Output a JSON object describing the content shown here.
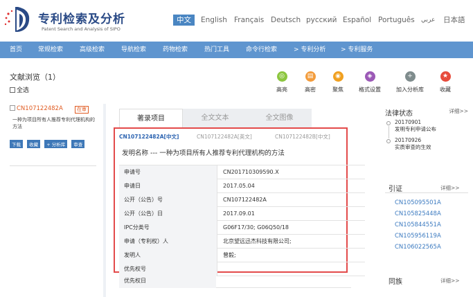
{
  "header": {
    "title": "专利检索及分析",
    "subtitle": "Patent Search and Analysis of SIPO"
  },
  "languages": [
    "中文",
    "English",
    "Français",
    "Deutsch",
    "русский",
    "Español",
    "Português",
    "عربي",
    "日本語"
  ],
  "nav": [
    "首页",
    "常规检索",
    "高级检索",
    "导航检索",
    "药物检索",
    "热门工具",
    "命令行检索",
    "> 专利分析",
    "> 专利服务"
  ],
  "toolbar": {
    "doc_browse": "文献浏览（1）",
    "select_all": "全选",
    "tools": [
      {
        "label": "高亮",
        "icon": "highlight-icon",
        "color": "#8cc63f",
        "glyph": "◎"
      },
      {
        "label": "高密",
        "icon": "dense-icon",
        "color": "#f39c3c",
        "glyph": "▤"
      },
      {
        "label": "聚焦",
        "icon": "focus-icon",
        "color": "#f0a020",
        "glyph": "◉"
      },
      {
        "label": "格式设置",
        "icon": "format-icon",
        "color": "#9b59b6",
        "glyph": "◈"
      },
      {
        "label": "加入分析库",
        "icon": "add-analysis-icon",
        "color": "#7f8c8d",
        "glyph": "+"
      },
      {
        "label": "收藏",
        "icon": "favorite-icon",
        "color": "#e74c3c",
        "glyph": "★"
      }
    ]
  },
  "left_list": {
    "id": "CN107122482A",
    "badge": "在审",
    "desc": "一种为项目所有人推荐专利代理机构的方法",
    "buttons": [
      "下载",
      "收藏",
      "+ 分析库",
      "审查"
    ]
  },
  "tabs": [
    "著录项目",
    "全文文本",
    "全文图像"
  ],
  "sub_tabs": [
    "CN107122482A[中文]",
    "CN107122482A[英文]",
    "CN107122482B[中文]"
  ],
  "invention_title": "发明名称 --- 一种为项目所有人推荐专利代理机构的方法",
  "table": [
    {
      "k": "申请号",
      "v": "CN201710309590.X"
    },
    {
      "k": "申请日",
      "v": "2017.05.04"
    },
    {
      "k": "公开（公告）号",
      "v": "CN107122482A"
    },
    {
      "k": "公开（公告）日",
      "v": "2017.09.01"
    },
    {
      "k": "IPC分类号",
      "v": "G06F17/30; G06Q50/18"
    },
    {
      "k": "申请（专利权）人",
      "v": "北京望远迅杰科技有限公司;"
    },
    {
      "k": "发明人",
      "v": "曾毅;"
    },
    {
      "k": "优先权号",
      "v": ""
    }
  ],
  "extra_row": "优先权日",
  "legal_status": {
    "title": "法律状态",
    "more": "详细>>",
    "events": [
      {
        "date": "20170901",
        "text": "发明专利申请公布"
      },
      {
        "date": "20170926",
        "text": "实质审查的生效"
      }
    ]
  },
  "citations": {
    "title": "引证",
    "more": "详细>>",
    "items": [
      "CN105095501A",
      "CN105825448A",
      "CN105844551A",
      "CN105956119A",
      "CN106022565A"
    ]
  },
  "same_family": {
    "title": "同族",
    "more": "详细>>"
  }
}
